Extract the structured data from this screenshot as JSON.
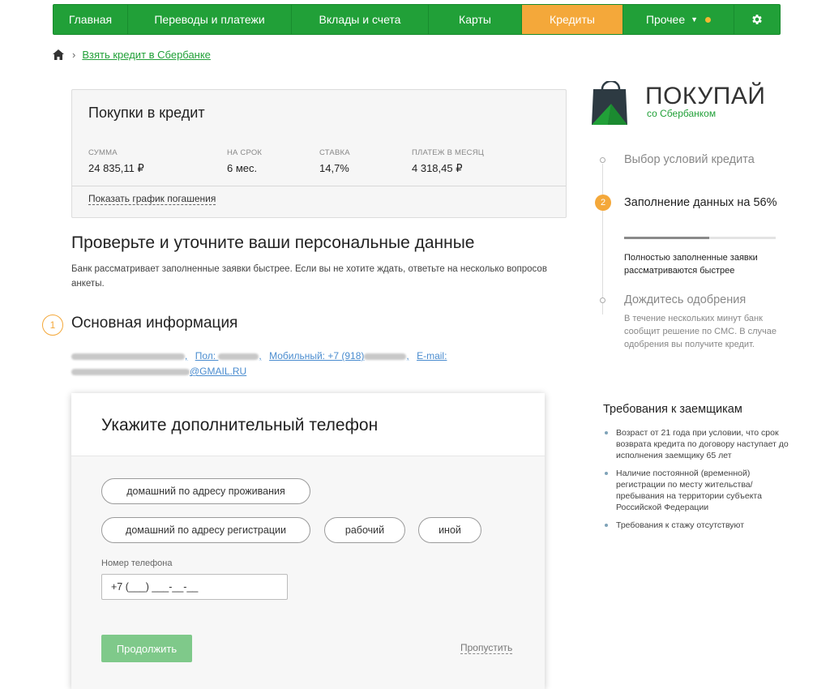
{
  "nav": {
    "items": [
      "Главная",
      "Переводы и платежи",
      "Вклады и счета",
      "Карты",
      "Кредиты",
      "Прочее"
    ],
    "active": "Кредиты",
    "accent_color": "#21a038",
    "active_color": "#f4a83a"
  },
  "breadcrumb": {
    "home_icon": "home-icon",
    "link": "Взять кредит в Сбербанке"
  },
  "credit": {
    "title": "Покупки в кредит",
    "sum_label": "СУММА",
    "sum_value": "24 835,11 ₽",
    "term_label": "НА СРОК",
    "term_value": "6 мес.",
    "rate_label": "СТАВКА",
    "rate_value": "14,7%",
    "payment_label": "ПЛАТЕЖ В МЕСЯЦ",
    "payment_value": "4 318,45 ₽",
    "schedule_link": "Показать график погашения"
  },
  "check": {
    "title": "Проверьте и уточните ваши персональные данные",
    "desc": "Банк рассматривает заполненные заявки быстрее. Если вы не хотите ждать, ответьте на несколько вопросов анкеты."
  },
  "basic": {
    "step": "1",
    "title": "Основная информация",
    "gender_label": "Пол:",
    "mobile_label": "Мобильный: +7 (918)",
    "email_label": "E-mail:",
    "email_suffix": "@GMAIL.RU"
  },
  "phone_card": {
    "title": "Укажите дополнительный телефон",
    "options": [
      "домашний по адресу проживания",
      "домашний по адресу регистрации",
      "рабочий",
      "иной"
    ],
    "field_label": "Номер телефона",
    "field_value": "+7 (___) ___-__-__",
    "continue": "Продолжить",
    "skip": "Пропустить"
  },
  "logo": {
    "word": "ПОКУПАЙ",
    "sub": "со Сбербанком"
  },
  "steps": {
    "step1": "Выбор условий кредита",
    "step2_num": "2",
    "step2": "Заполнение данных на 56%",
    "progress_percent": 56,
    "step2_note": "Полностью заполненные заявки рассматриваются быстрее",
    "step3": "Дождитесь одобрения",
    "step3_note": "В течение нескольких минут банк сообщит решение по СМС. В случае одобрения вы получите кредит."
  },
  "requirements": {
    "title": "Требования к заемщикам",
    "items": [
      "Возраст от 21 года при условии, что срок возврата кредита по договору наступает до исполнения заемщику 65 лет",
      "Наличие постоянной (временной) регистрации по месту жительства/пребывания на территории субъекта Российской Федерации",
      "Требования к стажу отсутствуют"
    ]
  }
}
